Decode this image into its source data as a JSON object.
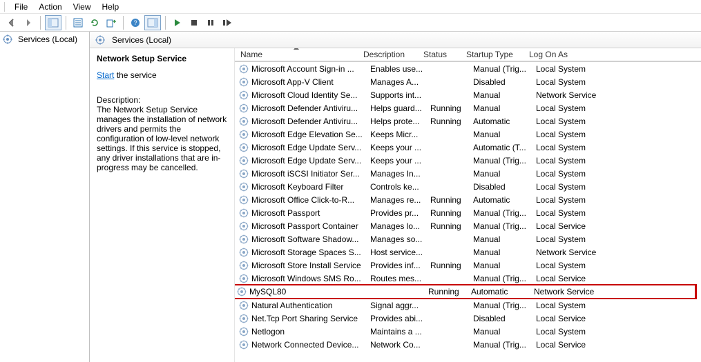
{
  "menu": [
    "File",
    "Action",
    "View",
    "Help"
  ],
  "nav": {
    "root": "Services (Local)"
  },
  "header": {
    "title": "Services (Local)"
  },
  "detail": {
    "service_name": "Network Setup Service",
    "start_link": "Start",
    "start_suffix": " the service",
    "desc_label": "Description:",
    "desc_text": "The Network Setup Service manages the installation of network drivers and permits the configuration of low-level network settings.  If this service is stopped, any driver installations that are in-progress may be cancelled."
  },
  "columns": {
    "name": "Name",
    "desc": "Description",
    "status": "Status",
    "startup": "Startup Type",
    "logon": "Log On As"
  },
  "services": [
    {
      "name": "Microsoft Account Sign-in ...",
      "desc": "Enables use...",
      "status": "",
      "startup": "Manual (Trig...",
      "logon": "Local System",
      "hl": false
    },
    {
      "name": "Microsoft App-V Client",
      "desc": "Manages A...",
      "status": "",
      "startup": "Disabled",
      "logon": "Local System",
      "hl": false
    },
    {
      "name": "Microsoft Cloud Identity Se...",
      "desc": "Supports int...",
      "status": "",
      "startup": "Manual",
      "logon": "Network Service",
      "hl": false
    },
    {
      "name": "Microsoft Defender Antiviru...",
      "desc": "Helps guard...",
      "status": "Running",
      "startup": "Manual",
      "logon": "Local System",
      "hl": false
    },
    {
      "name": "Microsoft Defender Antiviru...",
      "desc": "Helps prote...",
      "status": "Running",
      "startup": "Automatic",
      "logon": "Local System",
      "hl": false
    },
    {
      "name": "Microsoft Edge Elevation Se...",
      "desc": "Keeps Micr...",
      "status": "",
      "startup": "Manual",
      "logon": "Local System",
      "hl": false
    },
    {
      "name": "Microsoft Edge Update Serv...",
      "desc": "Keeps your ...",
      "status": "",
      "startup": "Automatic (T...",
      "logon": "Local System",
      "hl": false
    },
    {
      "name": "Microsoft Edge Update Serv...",
      "desc": "Keeps your ...",
      "status": "",
      "startup": "Manual (Trig...",
      "logon": "Local System",
      "hl": false
    },
    {
      "name": "Microsoft iSCSI Initiator Ser...",
      "desc": "Manages In...",
      "status": "",
      "startup": "Manual",
      "logon": "Local System",
      "hl": false
    },
    {
      "name": "Microsoft Keyboard Filter",
      "desc": "Controls ke...",
      "status": "",
      "startup": "Disabled",
      "logon": "Local System",
      "hl": false
    },
    {
      "name": "Microsoft Office Click-to-R...",
      "desc": "Manages re...",
      "status": "Running",
      "startup": "Automatic",
      "logon": "Local System",
      "hl": false
    },
    {
      "name": "Microsoft Passport",
      "desc": "Provides pr...",
      "status": "Running",
      "startup": "Manual (Trig...",
      "logon": "Local System",
      "hl": false
    },
    {
      "name": "Microsoft Passport Container",
      "desc": "Manages lo...",
      "status": "Running",
      "startup": "Manual (Trig...",
      "logon": "Local Service",
      "hl": false
    },
    {
      "name": "Microsoft Software Shadow...",
      "desc": "Manages so...",
      "status": "",
      "startup": "Manual",
      "logon": "Local System",
      "hl": false
    },
    {
      "name": "Microsoft Storage Spaces S...",
      "desc": "Host service...",
      "status": "",
      "startup": "Manual",
      "logon": "Network Service",
      "hl": false
    },
    {
      "name": "Microsoft Store Install Service",
      "desc": "Provides inf...",
      "status": "Running",
      "startup": "Manual",
      "logon": "Local System",
      "hl": false
    },
    {
      "name": "Microsoft Windows SMS Ro...",
      "desc": "Routes mes...",
      "status": "",
      "startup": "Manual (Trig...",
      "logon": "Local Service",
      "hl": false
    },
    {
      "name": "MySQL80",
      "desc": "",
      "status": "Running",
      "startup": "Automatic",
      "logon": "Network Service",
      "hl": true
    },
    {
      "name": "Natural Authentication",
      "desc": "Signal aggr...",
      "status": "",
      "startup": "Manual (Trig...",
      "logon": "Local System",
      "hl": false
    },
    {
      "name": "Net.Tcp Port Sharing Service",
      "desc": "Provides abi...",
      "status": "",
      "startup": "Disabled",
      "logon": "Local Service",
      "hl": false
    },
    {
      "name": "Netlogon",
      "desc": "Maintains a ...",
      "status": "",
      "startup": "Manual",
      "logon": "Local System",
      "hl": false
    },
    {
      "name": "Network Connected Device...",
      "desc": "Network Co...",
      "status": "",
      "startup": "Manual (Trig...",
      "logon": "Local Service",
      "hl": false
    }
  ]
}
